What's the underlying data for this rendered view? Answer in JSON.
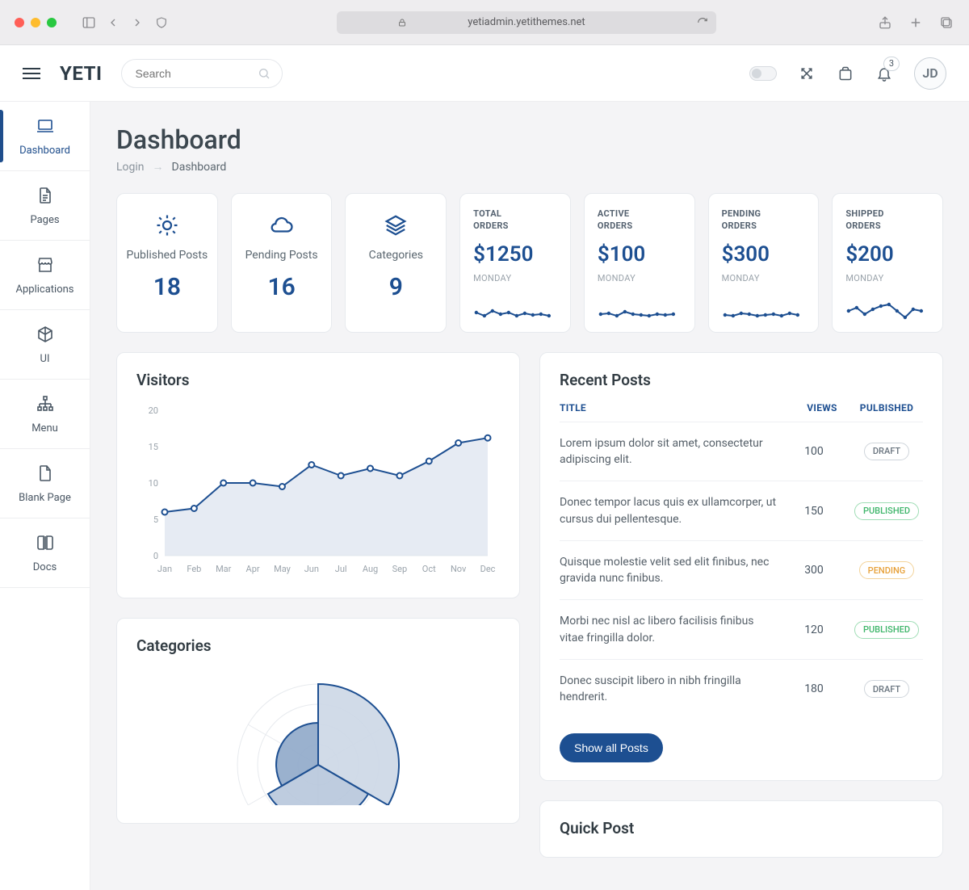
{
  "browser": {
    "url": "yetiadmin.yetithemes.net"
  },
  "brand": "YETI",
  "search": {
    "placeholder": "Search"
  },
  "notifications": {
    "count": "3"
  },
  "avatar": "JD",
  "sidebar": {
    "items": [
      {
        "label": "Dashboard"
      },
      {
        "label": "Pages"
      },
      {
        "label": "Applications"
      },
      {
        "label": "UI"
      },
      {
        "label": "Menu"
      },
      {
        "label": "Blank Page"
      },
      {
        "label": "Docs"
      }
    ]
  },
  "page": {
    "title": "Dashboard"
  },
  "breadcrumb": {
    "root": "Login",
    "current": "Dashboard"
  },
  "stats": {
    "published_posts": {
      "label": "Published Posts",
      "value": "18"
    },
    "pending_posts": {
      "label": "Pending Posts",
      "value": "16"
    },
    "categories": {
      "label": "Categories",
      "value": "9"
    },
    "total_orders": {
      "label_l1": "TOTAL",
      "label_l2": "ORDERS",
      "value": "$1250",
      "day": "MONDAY"
    },
    "active_orders": {
      "label_l1": "ACTIVE",
      "label_l2": "ORDERS",
      "value": "$100",
      "day": "MONDAY"
    },
    "pending_orders": {
      "label_l1": "PENDING",
      "label_l2": "ORDERS",
      "value": "$300",
      "day": "MONDAY"
    },
    "shipped_orders": {
      "label_l1": "SHIPPED",
      "label_l2": "ORDERS",
      "value": "$200",
      "day": "MONDAY"
    }
  },
  "visitors": {
    "title": "Visitors"
  },
  "categories_panel": {
    "title": "Categories"
  },
  "recent_posts": {
    "title": "Recent Posts",
    "columns": {
      "title": "TITLE",
      "views": "VIEWS",
      "published": "PULBISHED"
    },
    "rows": [
      {
        "text": "Lorem ipsum dolor sit amet, consectetur adipiscing elit.",
        "views": "100",
        "status": "DRAFT",
        "status_class": "draft"
      },
      {
        "text": "Donec tempor lacus quis ex ullamcorper, ut cursus dui pellentesque.",
        "views": "150",
        "status": "PUBLISHED",
        "status_class": "published"
      },
      {
        "text": "Quisque molestie velit sed elit finibus, nec gravida nunc finibus.",
        "views": "300",
        "status": "PENDING",
        "status_class": "pending"
      },
      {
        "text": "Morbi nec nisl ac libero facilisis finibus vitae fringilla dolor.",
        "views": "120",
        "status": "PUBLISHED",
        "status_class": "published"
      },
      {
        "text": "Donec suscipit libero in nibh fringilla hendrerit.",
        "views": "180",
        "status": "DRAFT",
        "status_class": "draft"
      }
    ],
    "button": "Show all Posts"
  },
  "quick_post": {
    "title": "Quick Post"
  },
  "chart_data": {
    "type": "line",
    "title": "Visitors",
    "xlabel": "",
    "ylabel": "",
    "ylim": [
      0,
      20
    ],
    "yticks": [
      0,
      5,
      10,
      15,
      20
    ],
    "categories": [
      "Jan",
      "Feb",
      "Mar",
      "Apr",
      "May",
      "Jun",
      "Jul",
      "Aug",
      "Sep",
      "Oct",
      "Nov",
      "Dec"
    ],
    "values": [
      6,
      6.5,
      10,
      10,
      9.5,
      12.5,
      11,
      12,
      11,
      13,
      15.5,
      16.2
    ]
  }
}
